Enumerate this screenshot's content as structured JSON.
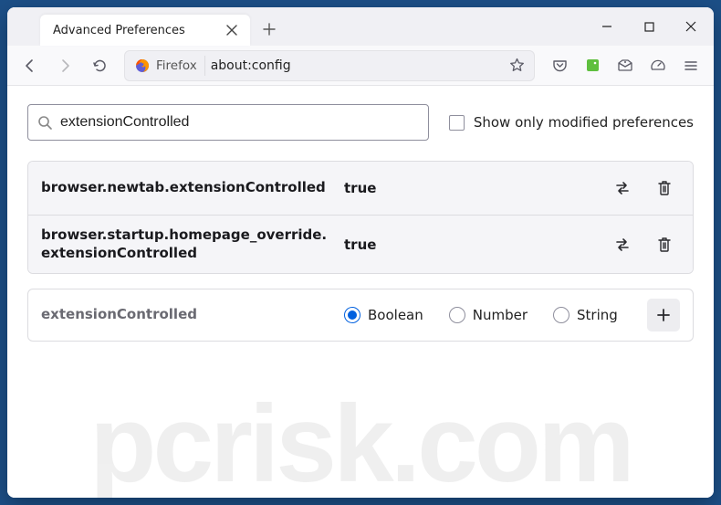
{
  "window": {
    "tab_title": "Advanced Preferences"
  },
  "urlbar": {
    "identity_label": "Firefox",
    "url": "about:config"
  },
  "search": {
    "value": "extensionControlled",
    "show_modified_label": "Show only modified preferences",
    "show_modified_checked": false
  },
  "prefs": [
    {
      "name": "browser.newtab.extensionControlled",
      "value": "true"
    },
    {
      "name": "browser.startup.homepage_override.extensionControlled",
      "value": "true"
    }
  ],
  "add_row": {
    "name": "extensionControlled",
    "types": [
      "Boolean",
      "Number",
      "String"
    ],
    "selected_type": "Boolean"
  },
  "watermark": "pcrisk.com"
}
